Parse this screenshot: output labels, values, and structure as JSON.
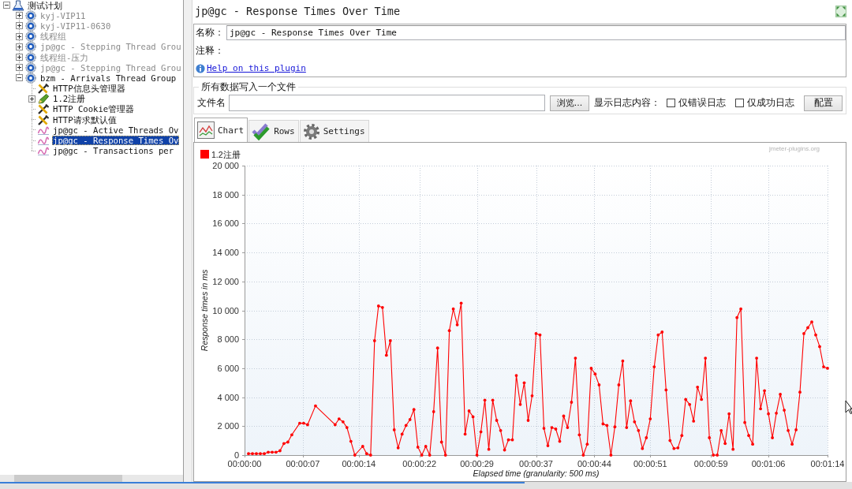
{
  "tree": {
    "label": "测试计划",
    "kind": "test-plan",
    "expanded": true,
    "selected": false,
    "disabled": false,
    "children": [
      {
        "label": "kyj-VIP11",
        "kind": "thread-group",
        "expanded": false,
        "selected": false,
        "disabled": true
      },
      {
        "label": "kyj-VIP11-0630",
        "kind": "thread-group",
        "expanded": false,
        "selected": false,
        "disabled": true
      },
      {
        "label": "线程组",
        "kind": "thread-group",
        "expanded": false,
        "selected": false,
        "disabled": true
      },
      {
        "label": "jp@gc - Stepping Thread Grou",
        "kind": "thread-group",
        "expanded": false,
        "selected": false,
        "disabled": true
      },
      {
        "label": "线程组-压力",
        "kind": "thread-group",
        "expanded": false,
        "selected": false,
        "disabled": true
      },
      {
        "label": "jp@gc - Stepping Thread Grou",
        "kind": "thread-group",
        "expanded": false,
        "selected": false,
        "disabled": true
      },
      {
        "label": "bzm - Arrivals Thread Group",
        "kind": "thread-group",
        "expanded": true,
        "selected": false,
        "disabled": false,
        "children": [
          {
            "label": "HTTP信息头管理器",
            "kind": "config",
            "selected": false,
            "disabled": false
          },
          {
            "label": "1.2注册",
            "kind": "controller",
            "expanded": false,
            "selected": false,
            "disabled": false
          },
          {
            "label": "HTTP Cookie管理器",
            "kind": "config",
            "selected": false,
            "disabled": false
          },
          {
            "label": "HTTP请求默认值",
            "kind": "config",
            "selected": false,
            "disabled": false
          },
          {
            "label": "jp@gc - Active Threads Ov",
            "kind": "listener",
            "selected": false,
            "disabled": false
          },
          {
            "label": "jp@gc - Response Times Ov",
            "kind": "listener",
            "selected": true,
            "disabled": false
          },
          {
            "label": "jp@gc - Transactions per",
            "kind": "listener",
            "selected": false,
            "disabled": false
          }
        ]
      }
    ]
  },
  "panel": {
    "title": "jp@gc - Response Times Over Time",
    "name_field": {
      "label": "名称：",
      "value": "jp@gc - Response Times Over Time"
    },
    "comment_label": "注释：",
    "help_link": "Help on this plugin"
  },
  "file_output": {
    "legend": "所有数据写入一个文件",
    "file_label": "文件名",
    "browse_button": "浏览...",
    "log_label": "显示日志内容：",
    "checkboxes": [
      {
        "label": "仅错误日志",
        "checked": false
      },
      {
        "label": "仅成功日志",
        "checked": false
      }
    ],
    "config_button": "配置"
  },
  "tabs": [
    {
      "label": "Chart",
      "kind": "chart",
      "selected": true
    },
    {
      "label": "Rows",
      "kind": "rows",
      "selected": false
    },
    {
      "label": "Settings",
      "kind": "settings",
      "selected": false
    }
  ],
  "chart": {
    "site_label": "jmeter-plugins.org",
    "chart_data": {
      "type": "line",
      "grid": true,
      "xlabel": "Elapsed time (granularity: 500 ms)",
      "ylabel": "Response times in ms",
      "x": [
        0.5,
        1,
        1.5,
        2,
        2.5,
        3,
        3.5,
        4,
        4.5,
        5,
        5.5,
        6,
        7,
        7.5,
        8,
        9,
        11.5,
        12,
        12.5,
        13,
        13.5,
        14,
        15,
        15.5,
        16,
        16.5,
        17,
        17.5,
        18,
        18.5,
        19,
        19.5,
        20,
        20.5,
        21,
        21.5,
        22,
        22.5,
        23,
        23.5,
        24,
        24.5,
        25,
        25.5,
        26,
        26.5,
        27,
        27.5,
        28,
        28.5,
        29,
        29.5,
        30,
        30.5,
        31,
        31.5,
        32,
        32.5,
        33,
        33.5,
        34,
        34.5,
        35,
        35.5,
        36,
        36.5,
        37,
        37.5,
        38,
        38.5,
        39,
        39.5,
        40,
        40.5,
        41,
        41.5,
        42,
        42.5,
        43,
        43.5,
        44,
        44.5,
        45,
        45.5,
        46,
        46.5,
        47,
        47.5,
        48,
        48.5,
        49,
        49.5,
        50,
        50.5,
        51,
        51.5,
        52,
        52.5,
        53,
        53.5,
        54,
        54.5,
        55,
        55.5,
        56,
        56.5,
        57,
        57.5,
        58,
        58.5,
        59,
        59.5,
        60,
        60.5,
        61,
        61.5,
        62,
        62.5,
        63,
        63.5,
        64,
        64.5,
        65,
        65.5,
        66,
        66.5,
        67,
        67.5,
        68,
        68.5,
        69,
        69.5,
        70,
        70.5,
        71,
        71.5,
        72,
        72.5,
        73,
        73.5,
        74
      ],
      "series": [
        {
          "name": "1.2注册",
          "color": "#ff0000",
          "values": [
            100,
            100,
            100,
            100,
            100,
            200,
            200,
            200,
            300,
            800,
            900,
            1400,
            2200,
            2200,
            2100,
            3400,
            2100,
            2500,
            2300,
            1900,
            950,
            0,
            600,
            100,
            0,
            7900,
            10300,
            10200,
            6900,
            7900,
            1750,
            500,
            1450,
            2050,
            2450,
            3150,
            550,
            0,
            600,
            0,
            3000,
            7400,
            900,
            0,
            8600,
            10100,
            9000,
            10500,
            1450,
            3050,
            2650,
            0,
            1600,
            3800,
            400,
            3800,
            2400,
            1700,
            350,
            1050,
            1050,
            5500,
            3500,
            5000,
            2400,
            4100,
            8400,
            8300,
            1850,
            650,
            1900,
            1800,
            950,
            2700,
            1900,
            3650,
            6700,
            1400,
            0,
            750,
            6000,
            5600,
            4850,
            2150,
            2050,
            0,
            1950,
            4850,
            6500,
            1900,
            3750,
            2300,
            1700,
            450,
            1200,
            2500,
            6100,
            8300,
            8500,
            4500,
            1000,
            450,
            500,
            1350,
            3850,
            3500,
            2350,
            4700,
            3850,
            6700,
            1200,
            0,
            0,
            1700,
            800,
            2850,
            400,
            9500,
            10100,
            2250,
            1350,
            750,
            6700,
            3200,
            4450,
            2850,
            1200,
            2900,
            4200,
            3100,
            1700,
            750,
            1750,
            4350,
            8400,
            8800,
            9200,
            8300,
            7500,
            6100,
            6000
          ]
        }
      ],
      "xlim": [
        0,
        74
      ],
      "ylim": [
        0,
        20000
      ],
      "xticks": [
        {
          "value": 0,
          "label": "00:00:00"
        },
        {
          "value": 7.4,
          "label": "00:00:07"
        },
        {
          "value": 14.5,
          "label": "00:00:14"
        },
        {
          "value": 22.2,
          "label": "00:00:22"
        },
        {
          "value": 29.5,
          "label": "00:00:29"
        },
        {
          "value": 37,
          "label": "00:00:37"
        },
        {
          "value": 44.4,
          "label": "00:00:44"
        },
        {
          "value": 51.5,
          "label": "00:00:51"
        },
        {
          "value": 59.2,
          "label": "00:00:59"
        },
        {
          "value": 66.5,
          "label": "00:01:06"
        },
        {
          "value": 74,
          "label": "00:01:14"
        }
      ],
      "yticks": [
        {
          "value": 0,
          "label": "0"
        },
        {
          "value": 2000,
          "label": "2 000"
        },
        {
          "value": 4000,
          "label": "4 000"
        },
        {
          "value": 6000,
          "label": "6 000"
        },
        {
          "value": 8000,
          "label": "8 000"
        },
        {
          "value": 10000,
          "label": "10 000"
        },
        {
          "value": 12000,
          "label": "12 000"
        },
        {
          "value": 14000,
          "label": "14 000"
        },
        {
          "value": 16000,
          "label": "16 000"
        },
        {
          "value": 18000,
          "label": "18 000"
        },
        {
          "value": 20000,
          "label": "20 000"
        }
      ]
    }
  }
}
